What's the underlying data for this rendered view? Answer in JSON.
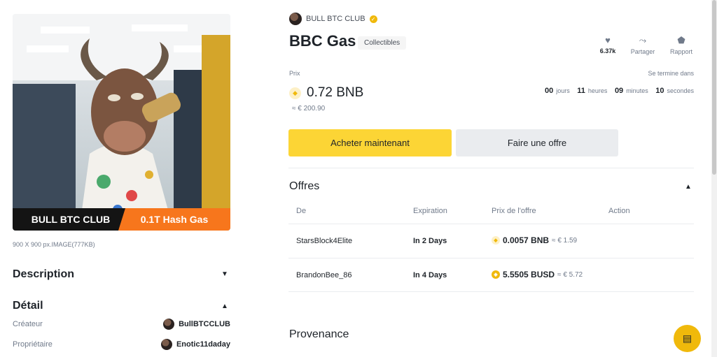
{
  "nft": {
    "collection_name": "BULL BTC CLUB",
    "title": "BBC Gas",
    "category_tag": "Collectibles",
    "image_label_left": "BULL BTC CLUB",
    "image_label_right": "0.1T Hash Gas",
    "image_meta": "900 X 900 px.IMAGE(777KB)"
  },
  "actions": {
    "likes": "6.37k",
    "share_label": "Partager",
    "report_label": "Rapport"
  },
  "price": {
    "label": "Prix",
    "value": "0.72 BNB",
    "fiat": "≈ € 200.90",
    "ends_label": "Se termine dans",
    "days": "00",
    "days_label": "jours",
    "hours": "11",
    "hours_label": "heures",
    "minutes": "09",
    "minutes_label": "minutes",
    "seconds": "10",
    "seconds_label": "secondes"
  },
  "buttons": {
    "buy": "Acheter maintenant",
    "make_offer": "Faire une offre"
  },
  "left_sections": {
    "description": "Description",
    "detail": "Détail",
    "creator_label": "Créateur",
    "creator_value": "BullBTCCLUB",
    "owner_label": "Propriétaire",
    "owner_value": "Enotic11daday"
  },
  "offers": {
    "title": "Offres",
    "headers": [
      "De",
      "Expiration",
      "Prix de l'offre",
      "Action"
    ],
    "rows": [
      {
        "from": "StarsBlock4Elite",
        "expiration": "In 2 Days",
        "amount": "0.0057 BNB",
        "fiat": "≈ € 1.59"
      },
      {
        "from": "BrandonBee_86",
        "expiration": "In 4 Days",
        "amount": "5.5505 BUSD",
        "fiat": "≈ € 5.72"
      }
    ]
  },
  "provenance": {
    "title": "Provenance"
  },
  "colors": {
    "accent": "#fcd535",
    "brand_orange": "#f7761c",
    "dark": "#141414"
  },
  "icons": [
    "verified-icon",
    "heart-icon",
    "share-icon",
    "report-icon",
    "bnb-coin-icon",
    "busd-coin-icon",
    "chevron-down-icon",
    "chevron-up-icon",
    "chat-icon"
  ]
}
